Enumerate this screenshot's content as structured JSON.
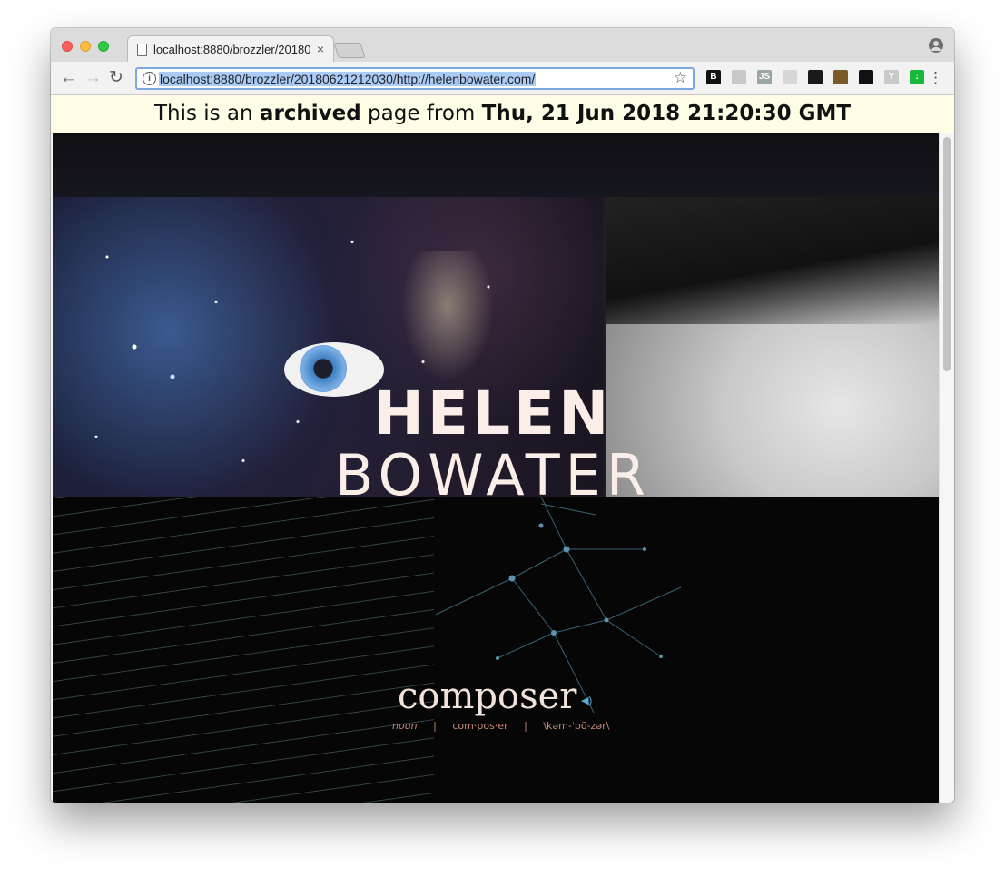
{
  "browser": {
    "tab": {
      "title": "localhost:8880/brozzler/2018062",
      "close": "×"
    },
    "toolbar": {
      "back": "←",
      "forward": "→",
      "reload": "↻",
      "url": "localhost:8880/brozzler/20180621212030/http://helenbowater.com/",
      "star": "☆",
      "menu": "⋮"
    },
    "extensions": [
      {
        "name": "extension-b",
        "label": "B",
        "color": "#111111"
      },
      {
        "name": "extension-camera",
        "label": "",
        "color": "#c8c8c8"
      },
      {
        "name": "extension-js",
        "label": "JS",
        "color": "#9aa6a0"
      },
      {
        "name": "extension-circle",
        "label": "",
        "color": "#d6d6d6"
      },
      {
        "name": "extension-bookmark",
        "label": "",
        "color": "#1a1a1a"
      },
      {
        "name": "extension-globe",
        "label": "",
        "color": "#7b5a2a"
      },
      {
        "name": "extension-archive",
        "label": "",
        "color": "#111111"
      },
      {
        "name": "extension-y",
        "label": "Y",
        "color": "#c9c9c9"
      },
      {
        "name": "extension-download",
        "label": "↓",
        "color": "#18b83c"
      }
    ]
  },
  "banner": {
    "prefix": "This is an",
    "emphasis": "archived",
    "middle": "page from",
    "date": "Thu, 21 Jun 2018 21:20:30 GMT"
  },
  "page": {
    "first_name": "HELEN",
    "last_name": "BOWATER",
    "word": "composer",
    "pos": "noun",
    "sep1": "|",
    "syllables": "com·pos·er",
    "sep2": "|",
    "ipa": "\\kəm-ˈpō-zər\\",
    "speaker": "◀)"
  }
}
